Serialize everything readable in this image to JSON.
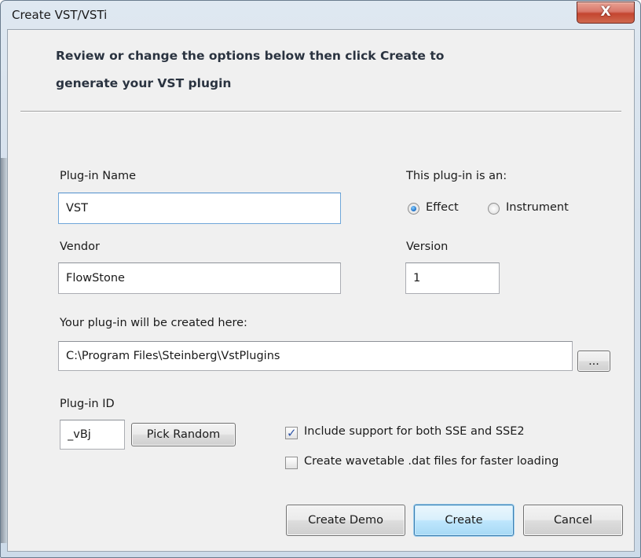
{
  "window": {
    "title": "Create VST/VSTi",
    "close_glyph": "X"
  },
  "heading": {
    "line1": "Review or change the options below then click Create to",
    "line2": "generate your VST plugin"
  },
  "plugin_name": {
    "label": "Plug-in Name",
    "value": "VST"
  },
  "plugin_type": {
    "label": "This plug-in is an:",
    "options": [
      "Effect",
      "Instrument"
    ],
    "selected": "Effect"
  },
  "vendor": {
    "label": "Vendor",
    "value": "FlowStone"
  },
  "version": {
    "label": "Version",
    "value": "1"
  },
  "location": {
    "label": "Your plug-in will be created here:",
    "value": "C:\\Program Files\\Steinberg\\VstPlugins",
    "browse_label": "..."
  },
  "plugin_id": {
    "label": "Plug-in ID",
    "value": "_vBj",
    "pick_random_label": "Pick Random"
  },
  "options": {
    "sse": {
      "label": "Include support for both SSE and SSE2",
      "checked": true
    },
    "wavetable": {
      "label": "Create wavetable .dat files for faster loading",
      "checked": false
    }
  },
  "buttons": {
    "create_demo": "Create Demo",
    "create": "Create",
    "cancel": "Cancel"
  },
  "colors": {
    "close_button": "#c9503c",
    "default_button_border": "#3c7fb1",
    "heading_text": "#2a3340"
  },
  "icons": {
    "close": "close-icon",
    "check": "checkmark-icon"
  }
}
